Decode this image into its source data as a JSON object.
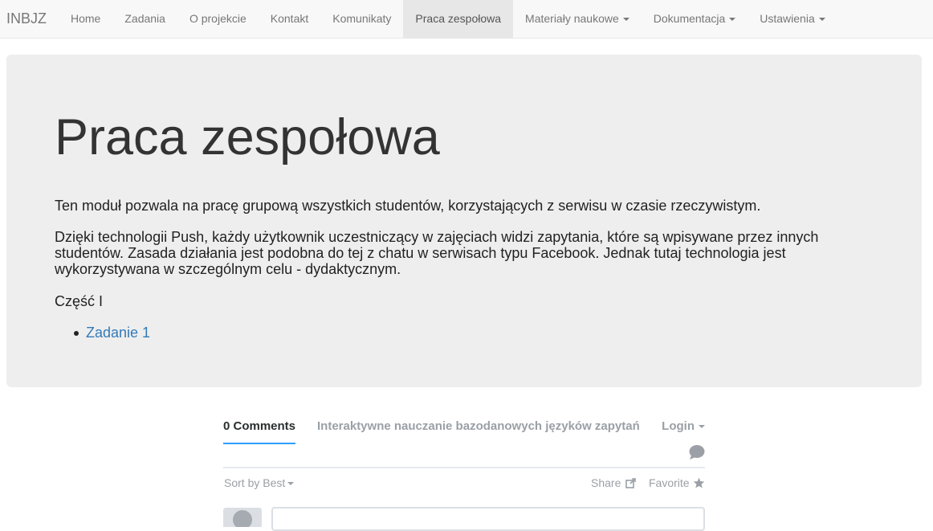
{
  "navbar": {
    "brand": "INBJZ",
    "items": [
      {
        "label": "Home"
      },
      {
        "label": "Zadania"
      },
      {
        "label": "O projekcie"
      },
      {
        "label": "Kontakt"
      },
      {
        "label": "Komunikaty"
      },
      {
        "label": "Praca zespołowa",
        "active": true
      },
      {
        "label": "Materiały naukowe",
        "dropdown": true
      },
      {
        "label": "Dokumentacja",
        "dropdown": true
      },
      {
        "label": "Ustawienia",
        "dropdown": true
      }
    ]
  },
  "jumbotron": {
    "title": "Praca zespołowa",
    "paragraph1": "Ten moduł pozwala na pracę grupową wszystkich studentów, korzystających z serwisu w czasie rzeczywistym.",
    "paragraph2": "Dzięki technologii Push, każdy użytkownik uczestniczący w zajęciach widzi zapytania, które są wpisywane przez innych studentów. Zasada działania jest podobna do tej z chatu w serwisach typu Facebook. Jednak tutaj technologia jest wykorzystywana w szczególnym celu - dydaktycznym.",
    "section_label": "Część I",
    "links": [
      {
        "label": "Zadanie 1"
      }
    ]
  },
  "comments": {
    "count_label": "0 Comments",
    "site_name": "Interaktywne nauczanie bazodanowych języków zapytań",
    "login_label": "Login",
    "sort_label": "Sort by Best",
    "share_label": "Share",
    "favorite_label": "Favorite",
    "icons": [
      "speech-bubble-icon",
      "share-icon",
      "star-icon",
      "avatar-icon"
    ]
  },
  "colors": {
    "navbar_bg": "#f8f8f8",
    "jumbotron_bg": "#eeeeee",
    "link": "#337ab7",
    "tab_underline": "#2e9fff"
  }
}
